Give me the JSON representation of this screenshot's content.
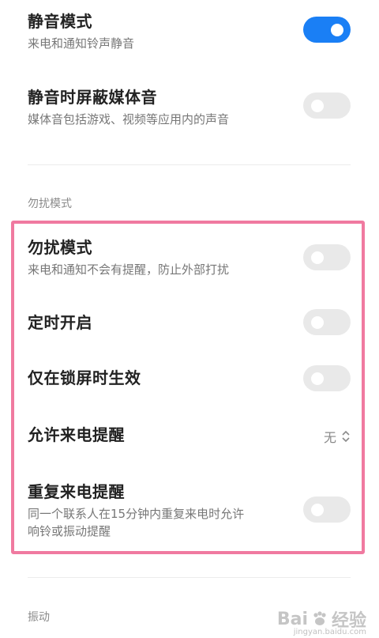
{
  "settings": {
    "silent_mode": {
      "title": "静音模式",
      "subtitle": "来电和通知铃声静音",
      "enabled": true
    },
    "mute_media": {
      "title": "静音时屏蔽媒体音",
      "subtitle": "媒体音包括游戏、视频等应用内的声音",
      "enabled": false
    }
  },
  "dnd_section": {
    "label": "勿扰模式",
    "items": [
      {
        "title": "勿扰模式",
        "subtitle": "来电和通知不会有提醒，防止外部打扰",
        "enabled": false
      },
      {
        "title": "定时开启",
        "enabled": false
      },
      {
        "title": "仅在锁屏时生效",
        "enabled": false
      },
      {
        "title": "允许来电提醒",
        "value": "无"
      },
      {
        "title": "重复来电提醒",
        "subtitle_line1": "同一个联系人在15分钟内重复来电时允许",
        "subtitle_line2": "响铃或振动提醒",
        "enabled": false
      }
    ]
  },
  "vibration_section": {
    "label": "振动"
  },
  "watermark": {
    "text": "Bai",
    "text2": "经验",
    "small": "jingyan.baidu.com"
  },
  "colors": {
    "accent": "#1a7ff5",
    "highlight": "#f07aa0",
    "toggle_off": "#e9e9e9"
  }
}
